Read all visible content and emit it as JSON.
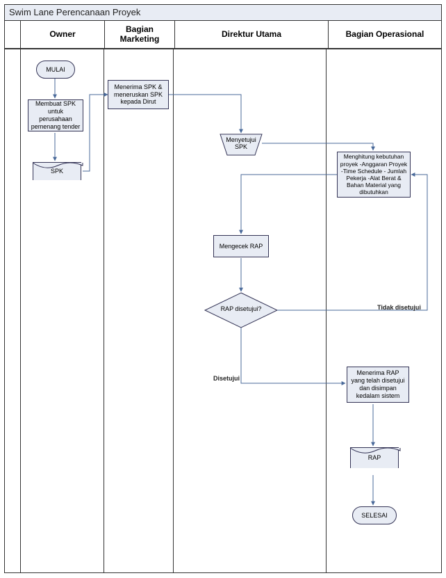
{
  "title": "Swim Lane Perencanaan Proyek",
  "lanes": {
    "owner": "Owner",
    "marketing": "Bagian Marketing",
    "direktur": "Direktur Utama",
    "operasional": "Bagian Operasional"
  },
  "nodes": {
    "start": "MULAI",
    "membuat_spk": "Membuat SPK untuk perusahaan pemenang tender",
    "spk_doc": "SPK",
    "menerima_spk": "Menerima SPK & meneruskan SPK kepada Dirut",
    "menyetujui_spk": "Menyetujui SPK",
    "menghitung": "Menghitung kebutuhan proyek\n-Anggaran Proyek\n-Time Schedule\n- Jumlah Pekerja\n-Alat Berat & Bahan Material yang dibutuhkan",
    "mengecek_rap": "Mengecek RAP",
    "rap_disetujui": "RAP disetujui?",
    "menerima_rap": "Menerima RAP yang telah disetujui dan disimpan kedalam sistem",
    "rap_doc": "RAP",
    "end": "SELESAI"
  },
  "edges": {
    "disetujui": "Disetujui",
    "tidak_disetujui": "Tidak disetujui"
  },
  "chart_data": {
    "type": "swimlane_flowchart",
    "title": "Swim Lane Perencanaan Proyek",
    "lanes": [
      "Owner",
      "Bagian Marketing",
      "Direktur Utama",
      "Bagian Operasional"
    ],
    "nodes": [
      {
        "id": "start",
        "lane": "Owner",
        "type": "terminator",
        "label": "MULAI"
      },
      {
        "id": "membuat_spk",
        "lane": "Owner",
        "type": "process",
        "label": "Membuat SPK untuk perusahaan pemenang tender"
      },
      {
        "id": "spk_doc",
        "lane": "Owner",
        "type": "document",
        "label": "SPK"
      },
      {
        "id": "menerima_spk",
        "lane": "Bagian Marketing",
        "type": "process",
        "label": "Menerima SPK & meneruskan SPK kepada Dirut"
      },
      {
        "id": "menyetujui_spk",
        "lane": "Direktur Utama",
        "type": "manual_operation",
        "label": "Menyetujui SPK"
      },
      {
        "id": "menghitung",
        "lane": "Bagian Operasional",
        "type": "process",
        "label": "Menghitung kebutuhan proyek -Anggaran Proyek -Time Schedule - Jumlah Pekerja -Alat Berat & Bahan Material yang dibutuhkan"
      },
      {
        "id": "mengecek_rap",
        "lane": "Direktur Utama",
        "type": "process",
        "label": "Mengecek RAP"
      },
      {
        "id": "rap_disetujui",
        "lane": "Direktur Utama",
        "type": "decision",
        "label": "RAP disetujui?"
      },
      {
        "id": "menerima_rap",
        "lane": "Bagian Operasional",
        "type": "process",
        "label": "Menerima RAP yang telah disetujui dan disimpan kedalam sistem"
      },
      {
        "id": "rap_doc",
        "lane": "Bagian Operasional",
        "type": "document",
        "label": "RAP"
      },
      {
        "id": "end",
        "lane": "Bagian Operasional",
        "type": "terminator",
        "label": "SELESAI"
      }
    ],
    "edges": [
      {
        "from": "start",
        "to": "membuat_spk"
      },
      {
        "from": "membuat_spk",
        "to": "spk_doc"
      },
      {
        "from": "spk_doc",
        "to": "menerima_spk"
      },
      {
        "from": "menerima_spk",
        "to": "menyetujui_spk"
      },
      {
        "from": "menyetujui_spk",
        "to": "menghitung"
      },
      {
        "from": "menghitung",
        "to": "mengecek_rap"
      },
      {
        "from": "mengecek_rap",
        "to": "rap_disetujui"
      },
      {
        "from": "rap_disetujui",
        "to": "menerima_rap",
        "label": "Disetujui"
      },
      {
        "from": "rap_disetujui",
        "to": "menghitung",
        "label": "Tidak disetujui"
      },
      {
        "from": "menerima_rap",
        "to": "rap_doc"
      },
      {
        "from": "rap_doc",
        "to": "end"
      }
    ]
  }
}
